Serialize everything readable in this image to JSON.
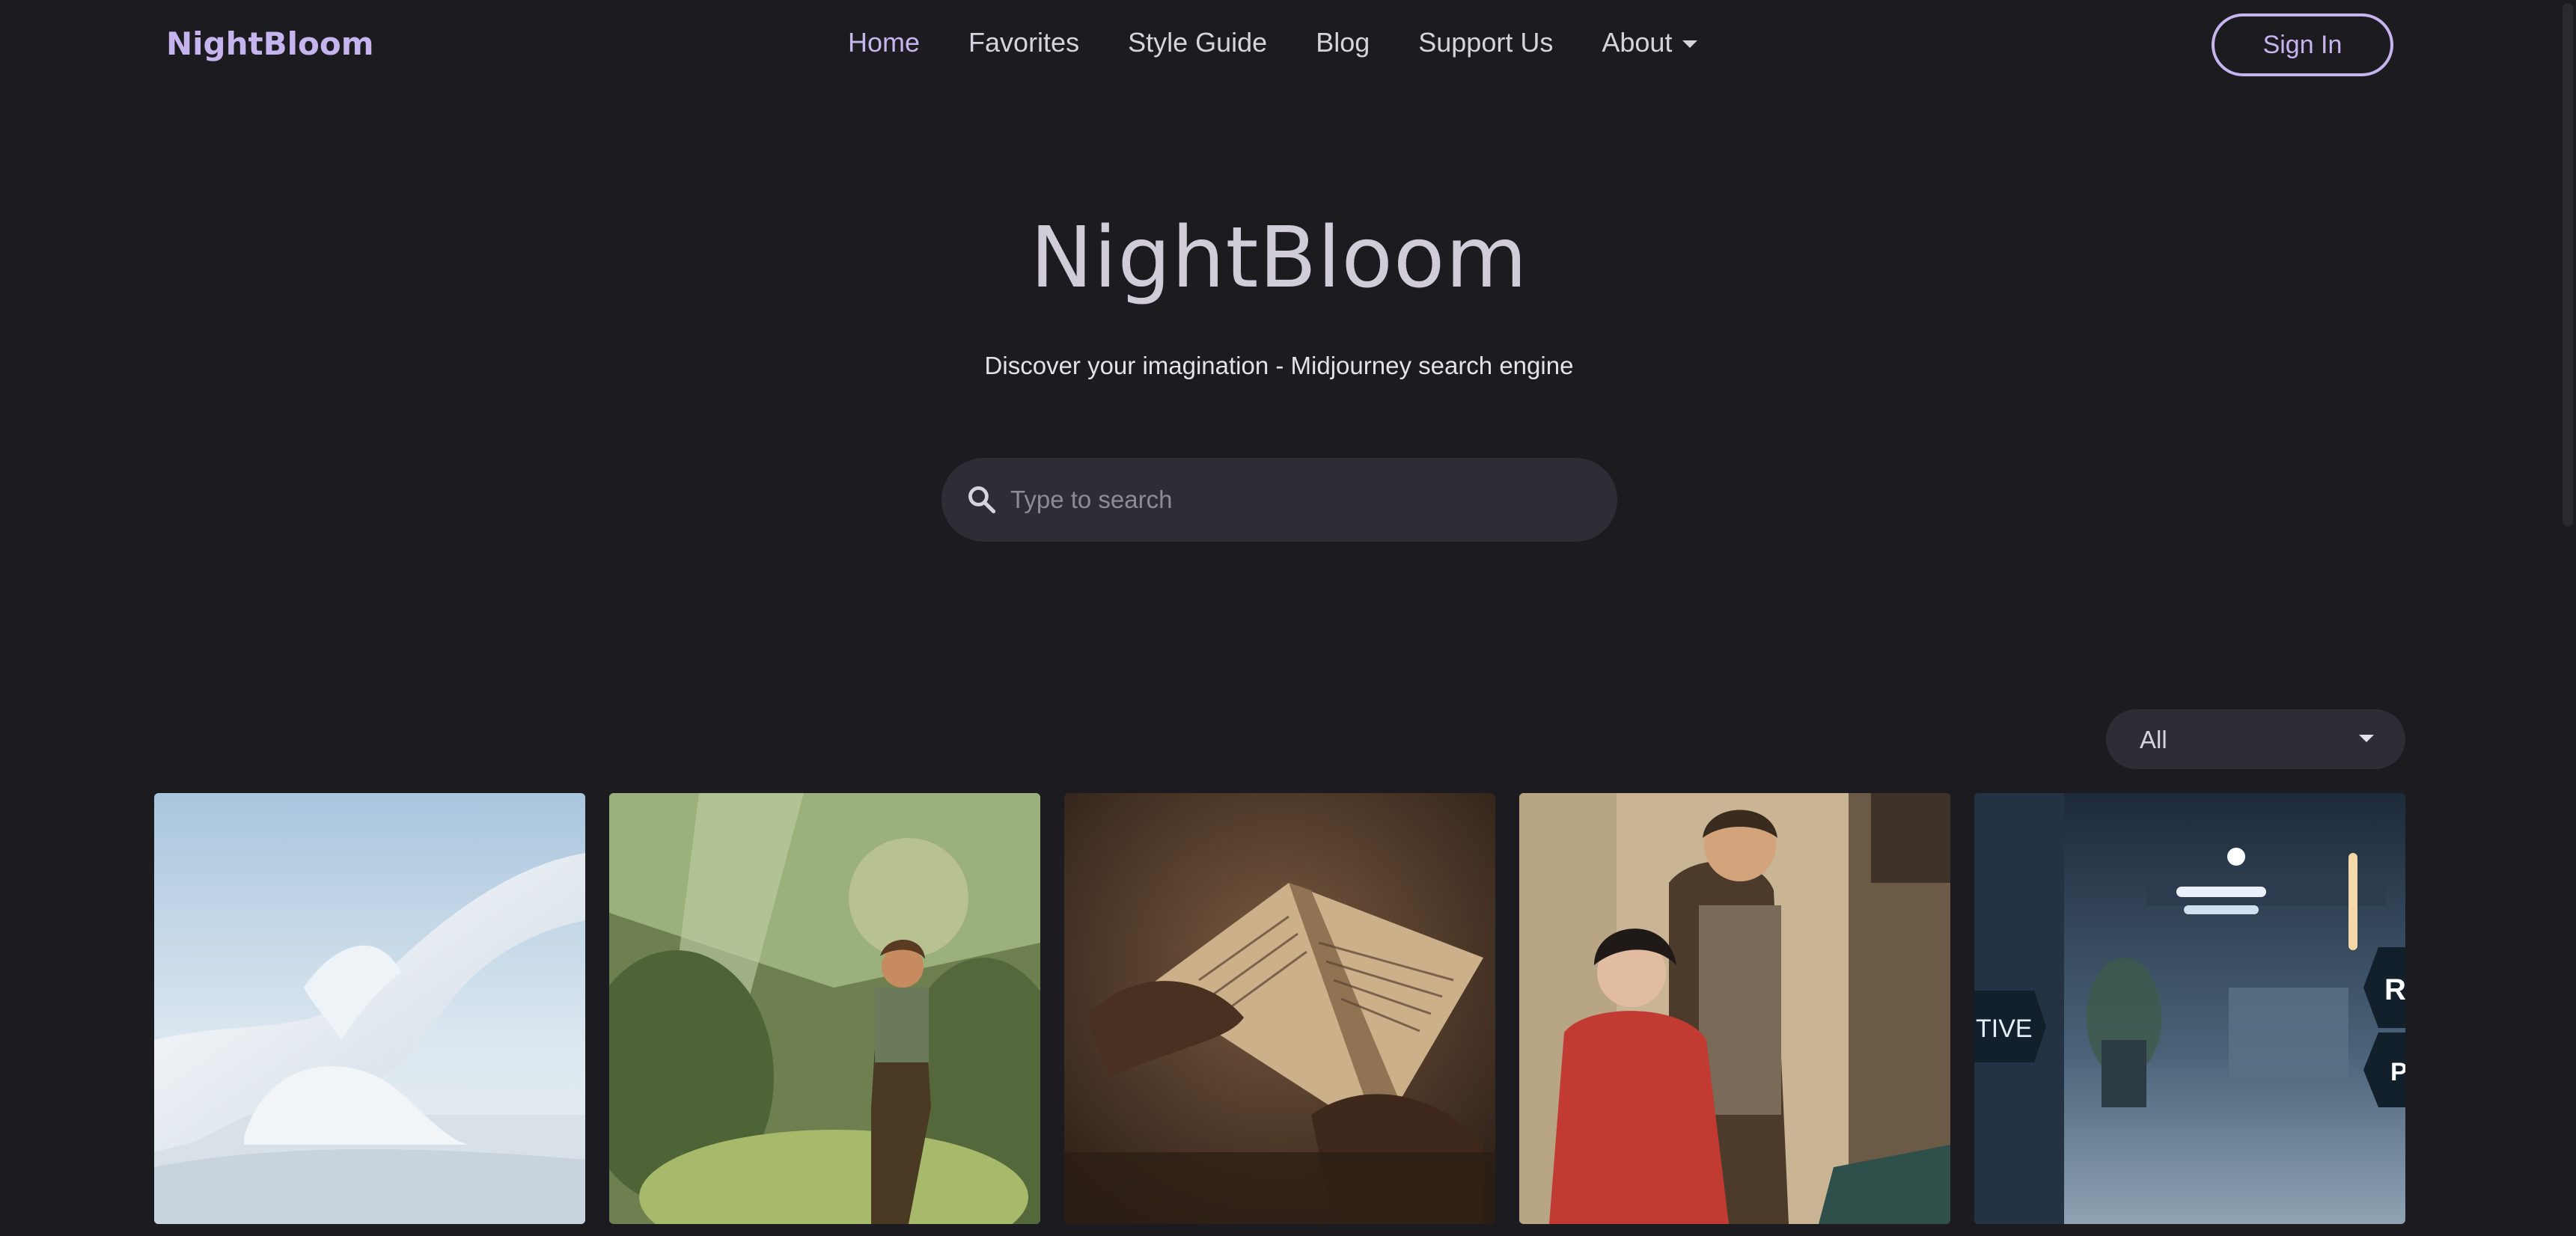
{
  "nav": {
    "logo": "NightBloom",
    "links": [
      {
        "label": "Home",
        "active": true
      },
      {
        "label": "Favorites",
        "active": false
      },
      {
        "label": "Style Guide",
        "active": false
      },
      {
        "label": "Blog",
        "active": false
      },
      {
        "label": "Support Us",
        "active": false
      },
      {
        "label": "About",
        "active": false,
        "dropdown": true
      }
    ],
    "signin_label": "Sign In"
  },
  "hero": {
    "title": "NightBloom",
    "subtitle": "Discover your imagination - Midjourney search engine"
  },
  "search": {
    "placeholder": "Type to search",
    "value": "",
    "icon": "search-icon"
  },
  "filter": {
    "selected": "All",
    "icon": "chevron-down-icon"
  },
  "gallery": {
    "items": [
      {
        "subject": "white futuristic curved architecture"
      },
      {
        "subject": "boy standing in sunlit forest"
      },
      {
        "subject": "hands holding an ancient book"
      },
      {
        "subject": "vintage illustrated couple"
      },
      {
        "subject": "blurred office hallway",
        "overlay_texts": [
          "TIVE",
          "RI",
          "P"
        ]
      }
    ]
  },
  "colors": {
    "background": "#1c1b20",
    "accent": "#c6b4ee",
    "surface": "#2e2d35",
    "text": "#d6d3dc"
  }
}
